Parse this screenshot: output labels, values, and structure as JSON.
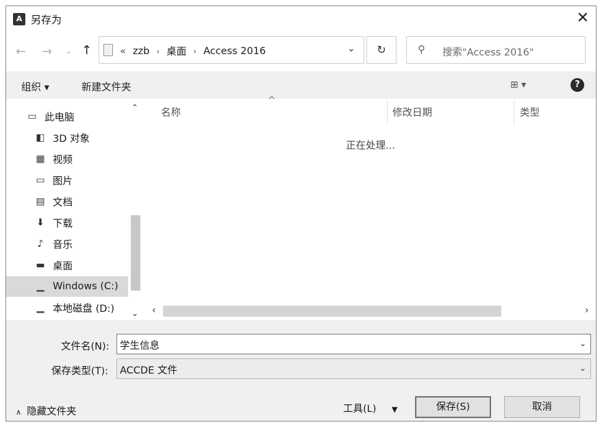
{
  "window": {
    "title": "另存为",
    "app_icon": "access-icon",
    "close_glyph": "✕"
  },
  "nav": {
    "back": "←",
    "forward": "→",
    "recent": "⌄",
    "up": "↑",
    "breadcrumb": {
      "overflow": "«",
      "items": [
        "zzb",
        "桌面",
        "Access 2016"
      ],
      "separator": "›"
    },
    "refresh": "↻",
    "search_placeholder": "搜索\"Access 2016\""
  },
  "toolbar": {
    "organize": "组织 ▾",
    "new_folder": "新建文件夹",
    "view": "⊞ ▾",
    "help": "?"
  },
  "sidebar": {
    "items": [
      {
        "label": "此电脑",
        "icon": "computer-icon",
        "glyph": "▭"
      },
      {
        "label": "3D 对象",
        "icon": "cube-icon",
        "glyph": "◧"
      },
      {
        "label": "视频",
        "icon": "film-icon",
        "glyph": "▦"
      },
      {
        "label": "图片",
        "icon": "picture-icon",
        "glyph": "▭"
      },
      {
        "label": "文档",
        "icon": "document-icon",
        "glyph": "▤"
      },
      {
        "label": "下载",
        "icon": "download-icon",
        "glyph": "⬇"
      },
      {
        "label": "音乐",
        "icon": "music-icon",
        "glyph": "♪"
      },
      {
        "label": "桌面",
        "icon": "desktop-icon",
        "glyph": "▬"
      },
      {
        "label": "Windows (C:)",
        "icon": "drive-icon",
        "glyph": "▁"
      },
      {
        "label": "本地磁盘 (D:)",
        "icon": "drive-icon",
        "glyph": "▁"
      }
    ],
    "selected_index": 8
  },
  "file_list": {
    "columns": [
      "名称",
      "修改日期",
      "类型"
    ],
    "status": "正在处理..."
  },
  "form": {
    "filename_label": "文件名(N):",
    "filename_value": "学生信息",
    "filetype_label": "保存类型(T):",
    "filetype_value": "ACCDE 文件"
  },
  "footer": {
    "hide_folders": "隐藏文件夹",
    "tools": "工具(L)",
    "save": "保存(S)",
    "cancel": "取消"
  }
}
